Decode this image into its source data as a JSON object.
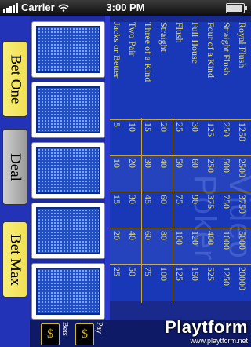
{
  "status": {
    "carrier": "Carrier",
    "time": "3:00 PM"
  },
  "buttons": {
    "bet_one": "Bet One",
    "deal": "Deal",
    "bet_max": "Bet Max"
  },
  "cards": [
    "card-back",
    "card-back",
    "card-back",
    "card-back",
    "card-back"
  ],
  "paytable": {
    "hands": [
      "Royal Flush",
      "Straight Flush",
      "Four of a Kind",
      "Full House",
      "Flush",
      "Straight",
      "Three of a Kind",
      "Two Pair",
      "Jacks or Better"
    ],
    "columns": [
      [
        "1250",
        "2500",
        "3750",
        "5000",
        "20000"
      ],
      [
        "250",
        "500",
        "750",
        "1000",
        "1250"
      ],
      [
        "125",
        "250",
        "375",
        "400",
        "525"
      ],
      [
        "30",
        "60",
        "90",
        "120",
        "150"
      ],
      [
        "25",
        "50",
        "75",
        "100",
        "125"
      ],
      [
        "20",
        "40",
        "60",
        "80",
        "100"
      ],
      [
        "15",
        "30",
        "45",
        "60",
        "75"
      ],
      [
        "10",
        "20",
        "30",
        "40",
        "50"
      ],
      [
        "5",
        "10",
        "15",
        "20",
        "25"
      ]
    ],
    "watermark": "Video Poker",
    "accent_color": "#f0e24a"
  },
  "bottom": {
    "bet_label": "Bets",
    "pay_label": "Pay",
    "bet_chip": "$",
    "pay_chip": "$"
  },
  "branding": {
    "name": "Playtform",
    "url": "www.playtform.net"
  }
}
